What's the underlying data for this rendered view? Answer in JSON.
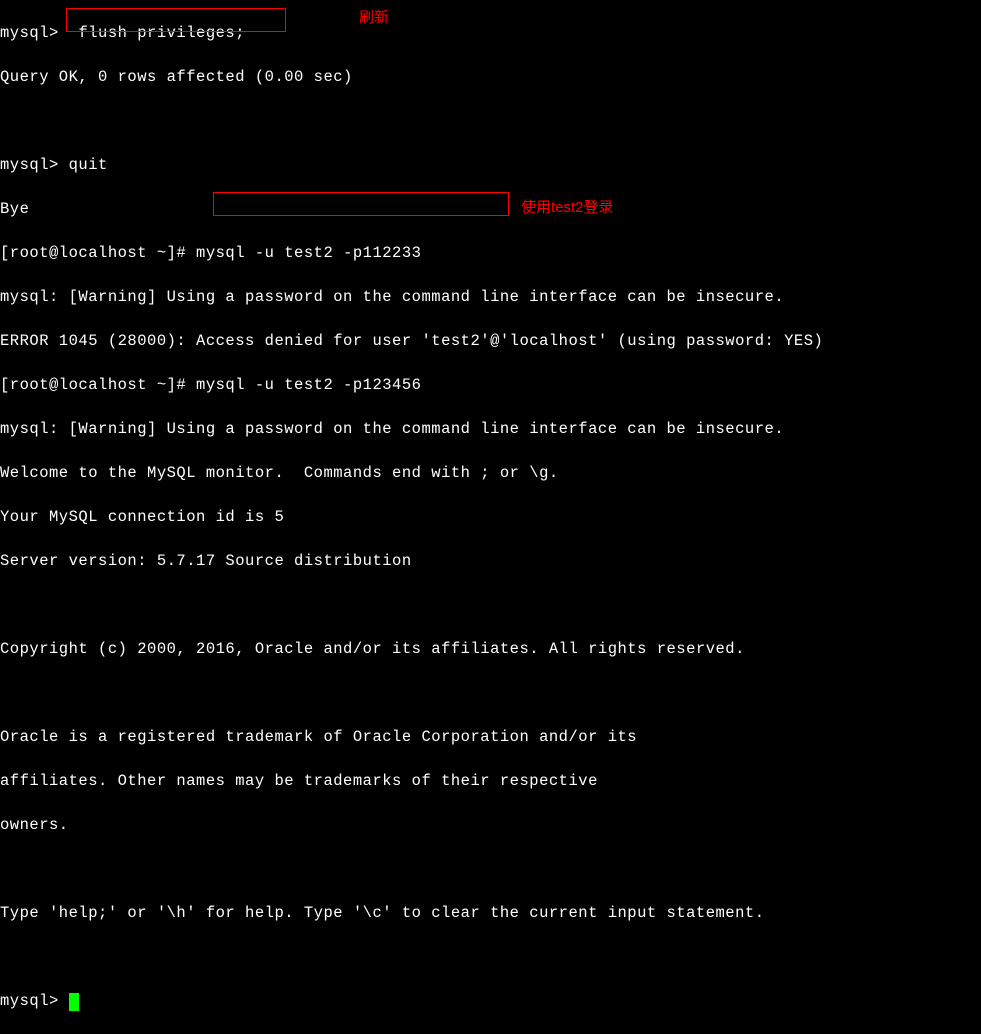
{
  "lines": {
    "l0": "mysql>  flush privileges;",
    "l1": "Query OK, 0 rows affected (0.00 sec)",
    "l2": "",
    "l3": "mysql> quit",
    "l4": "Bye",
    "l5": "[root@localhost ~]# mysql -u test2 -p112233",
    "l6": "mysql: [Warning] Using a password on the command line interface can be insecure.",
    "l7": "ERROR 1045 (28000): Access denied for user 'test2'@'localhost' (using password: YES)",
    "l8": "[root@localhost ~]# mysql -u test2 -p123456",
    "l9": "mysql: [Warning] Using a password on the command line interface can be insecure.",
    "l10": "Welcome to the MySQL monitor.  Commands end with ; or \\g.",
    "l11": "Your MySQL connection id is 5",
    "l12": "Server version: 5.7.17 Source distribution",
    "l13": "",
    "l14": "Copyright (c) 2000, 2016, Oracle and/or its affiliates. All rights reserved.",
    "l15": "",
    "l16": "Oracle is a registered trademark of Oracle Corporation and/or its",
    "l17": "affiliates. Other names may be trademarks of their respective",
    "l18": "owners.",
    "l19": "",
    "l20": "Type 'help;' or '\\h' for help. Type '\\c' to clear the current input statement.",
    "l21": "",
    "l22": "mysql> "
  },
  "annotations": {
    "a": "刷新",
    "b": "使用test2登录"
  }
}
